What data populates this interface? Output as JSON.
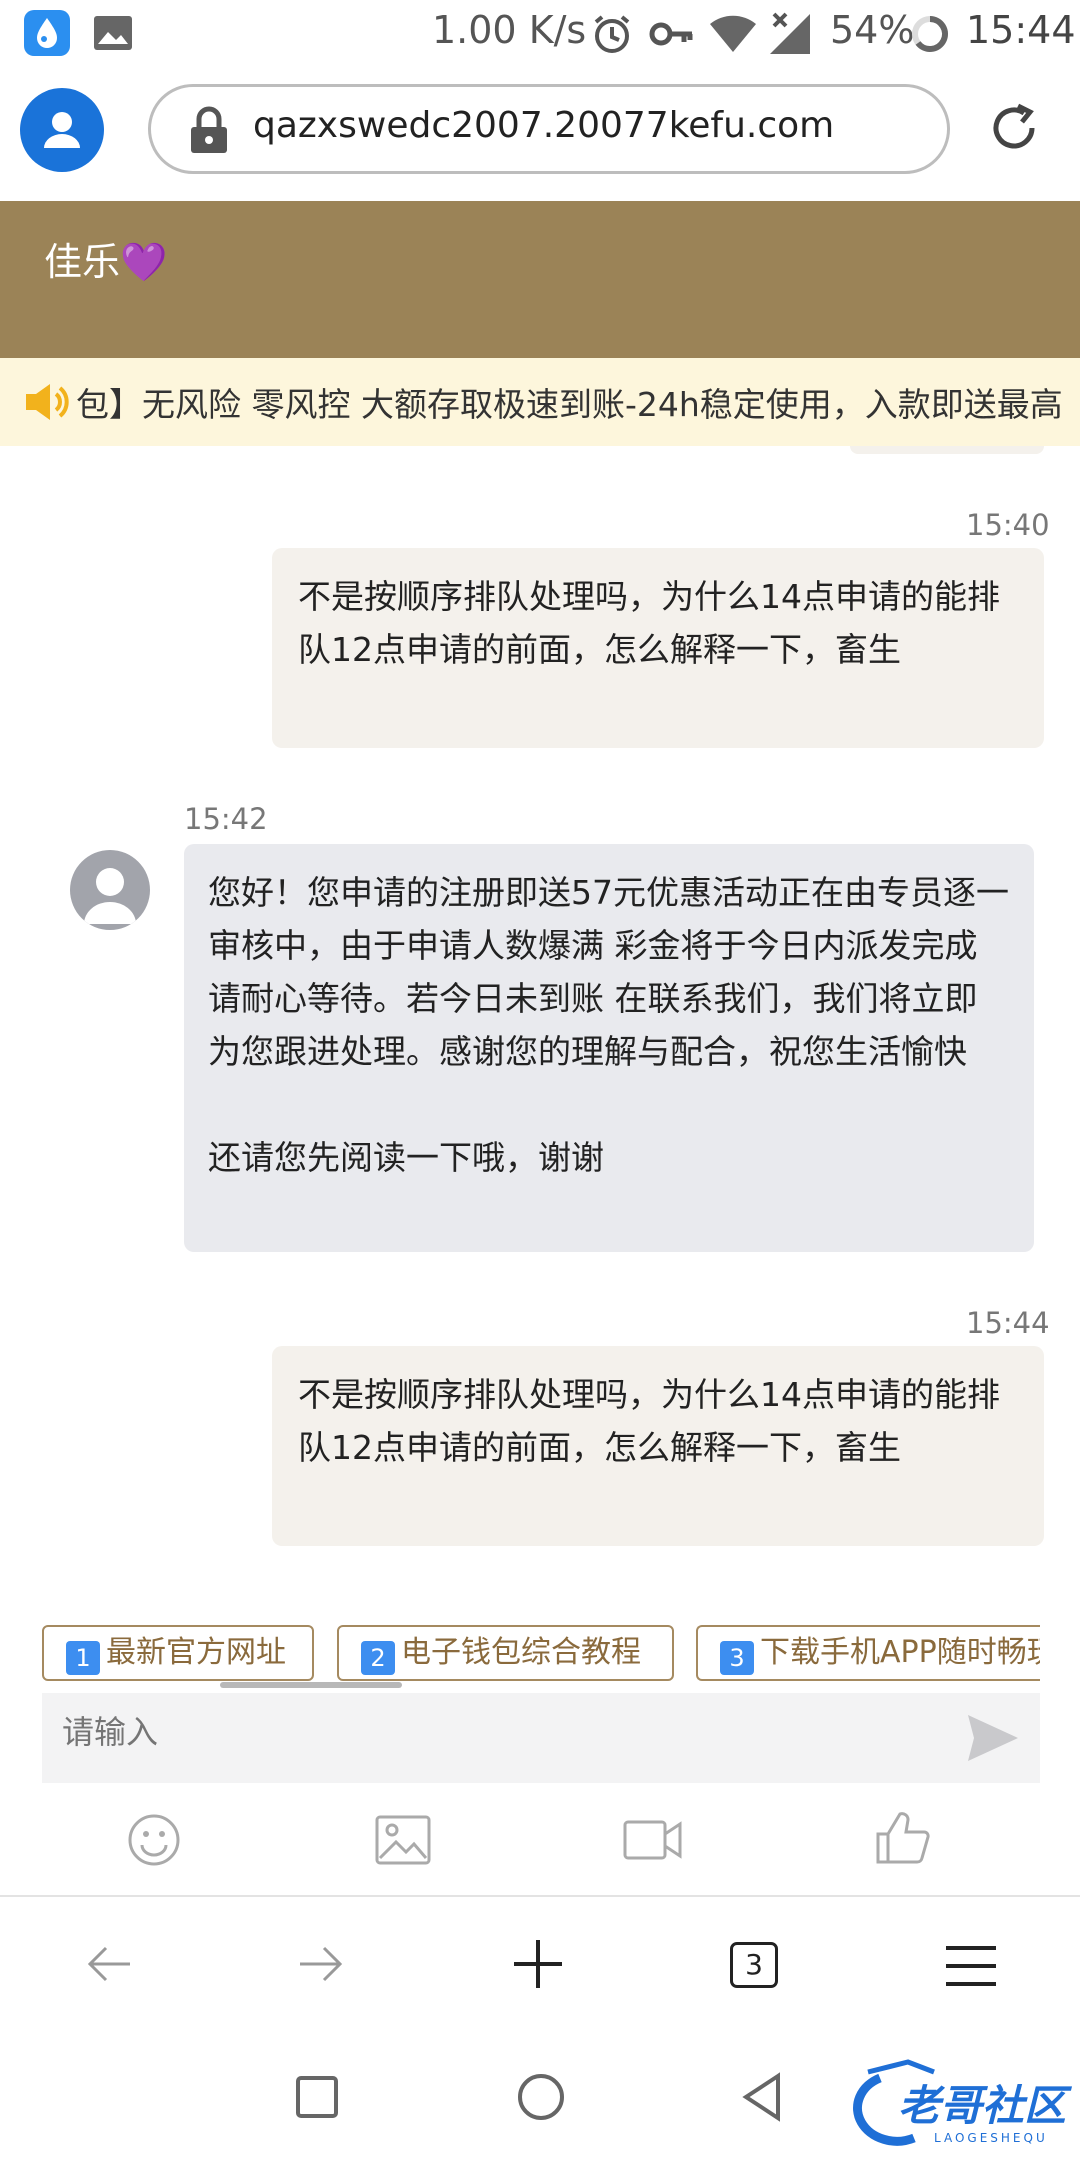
{
  "status_bar": {
    "speed": "1.00 K/s",
    "battery": "54%",
    "time": "15:44",
    "icons": [
      "drop-app-icon",
      "gallery-icon",
      "alarm-icon",
      "key-icon",
      "wifi-icon",
      "no-signal-icon",
      "battery-ring-icon"
    ]
  },
  "browser": {
    "url": "qazxswedc2007.20077kefu.com",
    "icons": [
      "profile-icon",
      "lock-icon",
      "reload-icon"
    ]
  },
  "chat": {
    "title": "佳乐💜",
    "marquee": "包】无风险 零风控 大额存取极速到账-24h稳定使用，入款即送最高",
    "messages": [
      {
        "time": "15:40",
        "from": "me",
        "text": "不是按顺序排队处理吗，为什么14点申请的能排队12点申请的前面，怎么解释一下，畜生"
      },
      {
        "time": "15:42",
        "from": "agent",
        "text": "您好！您申请的注册即送57元优惠活动正在由专员逐一审核中，由于申请人数爆满 彩金将于今日内派发完成 请耐心等待。若今日未到账 在联系我们，我们将立即为您跟进处理。感谢您的理解与配合，祝您生活愉快\n\n还请您先阅读一下哦，谢谢"
      },
      {
        "time": "15:44",
        "from": "me",
        "text": "不是按顺序排队处理吗，为什么14点申请的能排队12点申请的前面，怎么解释一下，畜生"
      }
    ],
    "quick_links": [
      {
        "num": "1",
        "label": "最新官方网址"
      },
      {
        "num": "2",
        "label": "电子钱包综合教程"
      },
      {
        "num": "3",
        "label": "下载手机APP随时畅玩"
      }
    ],
    "input_placeholder": "请输入"
  },
  "toolbar_icons": [
    "emoji-icon",
    "image-icon",
    "video-icon",
    "like-icon"
  ],
  "browser_nav": {
    "tab_count": "3"
  },
  "watermark": {
    "text": "老哥社区",
    "sub": "LAOGESHEQU"
  },
  "colors": {
    "header_bg": "#9b8357",
    "marquee_bg": "#fdf6dc",
    "accent_blue": "#1a73d9",
    "link_border": "#a58a60"
  }
}
